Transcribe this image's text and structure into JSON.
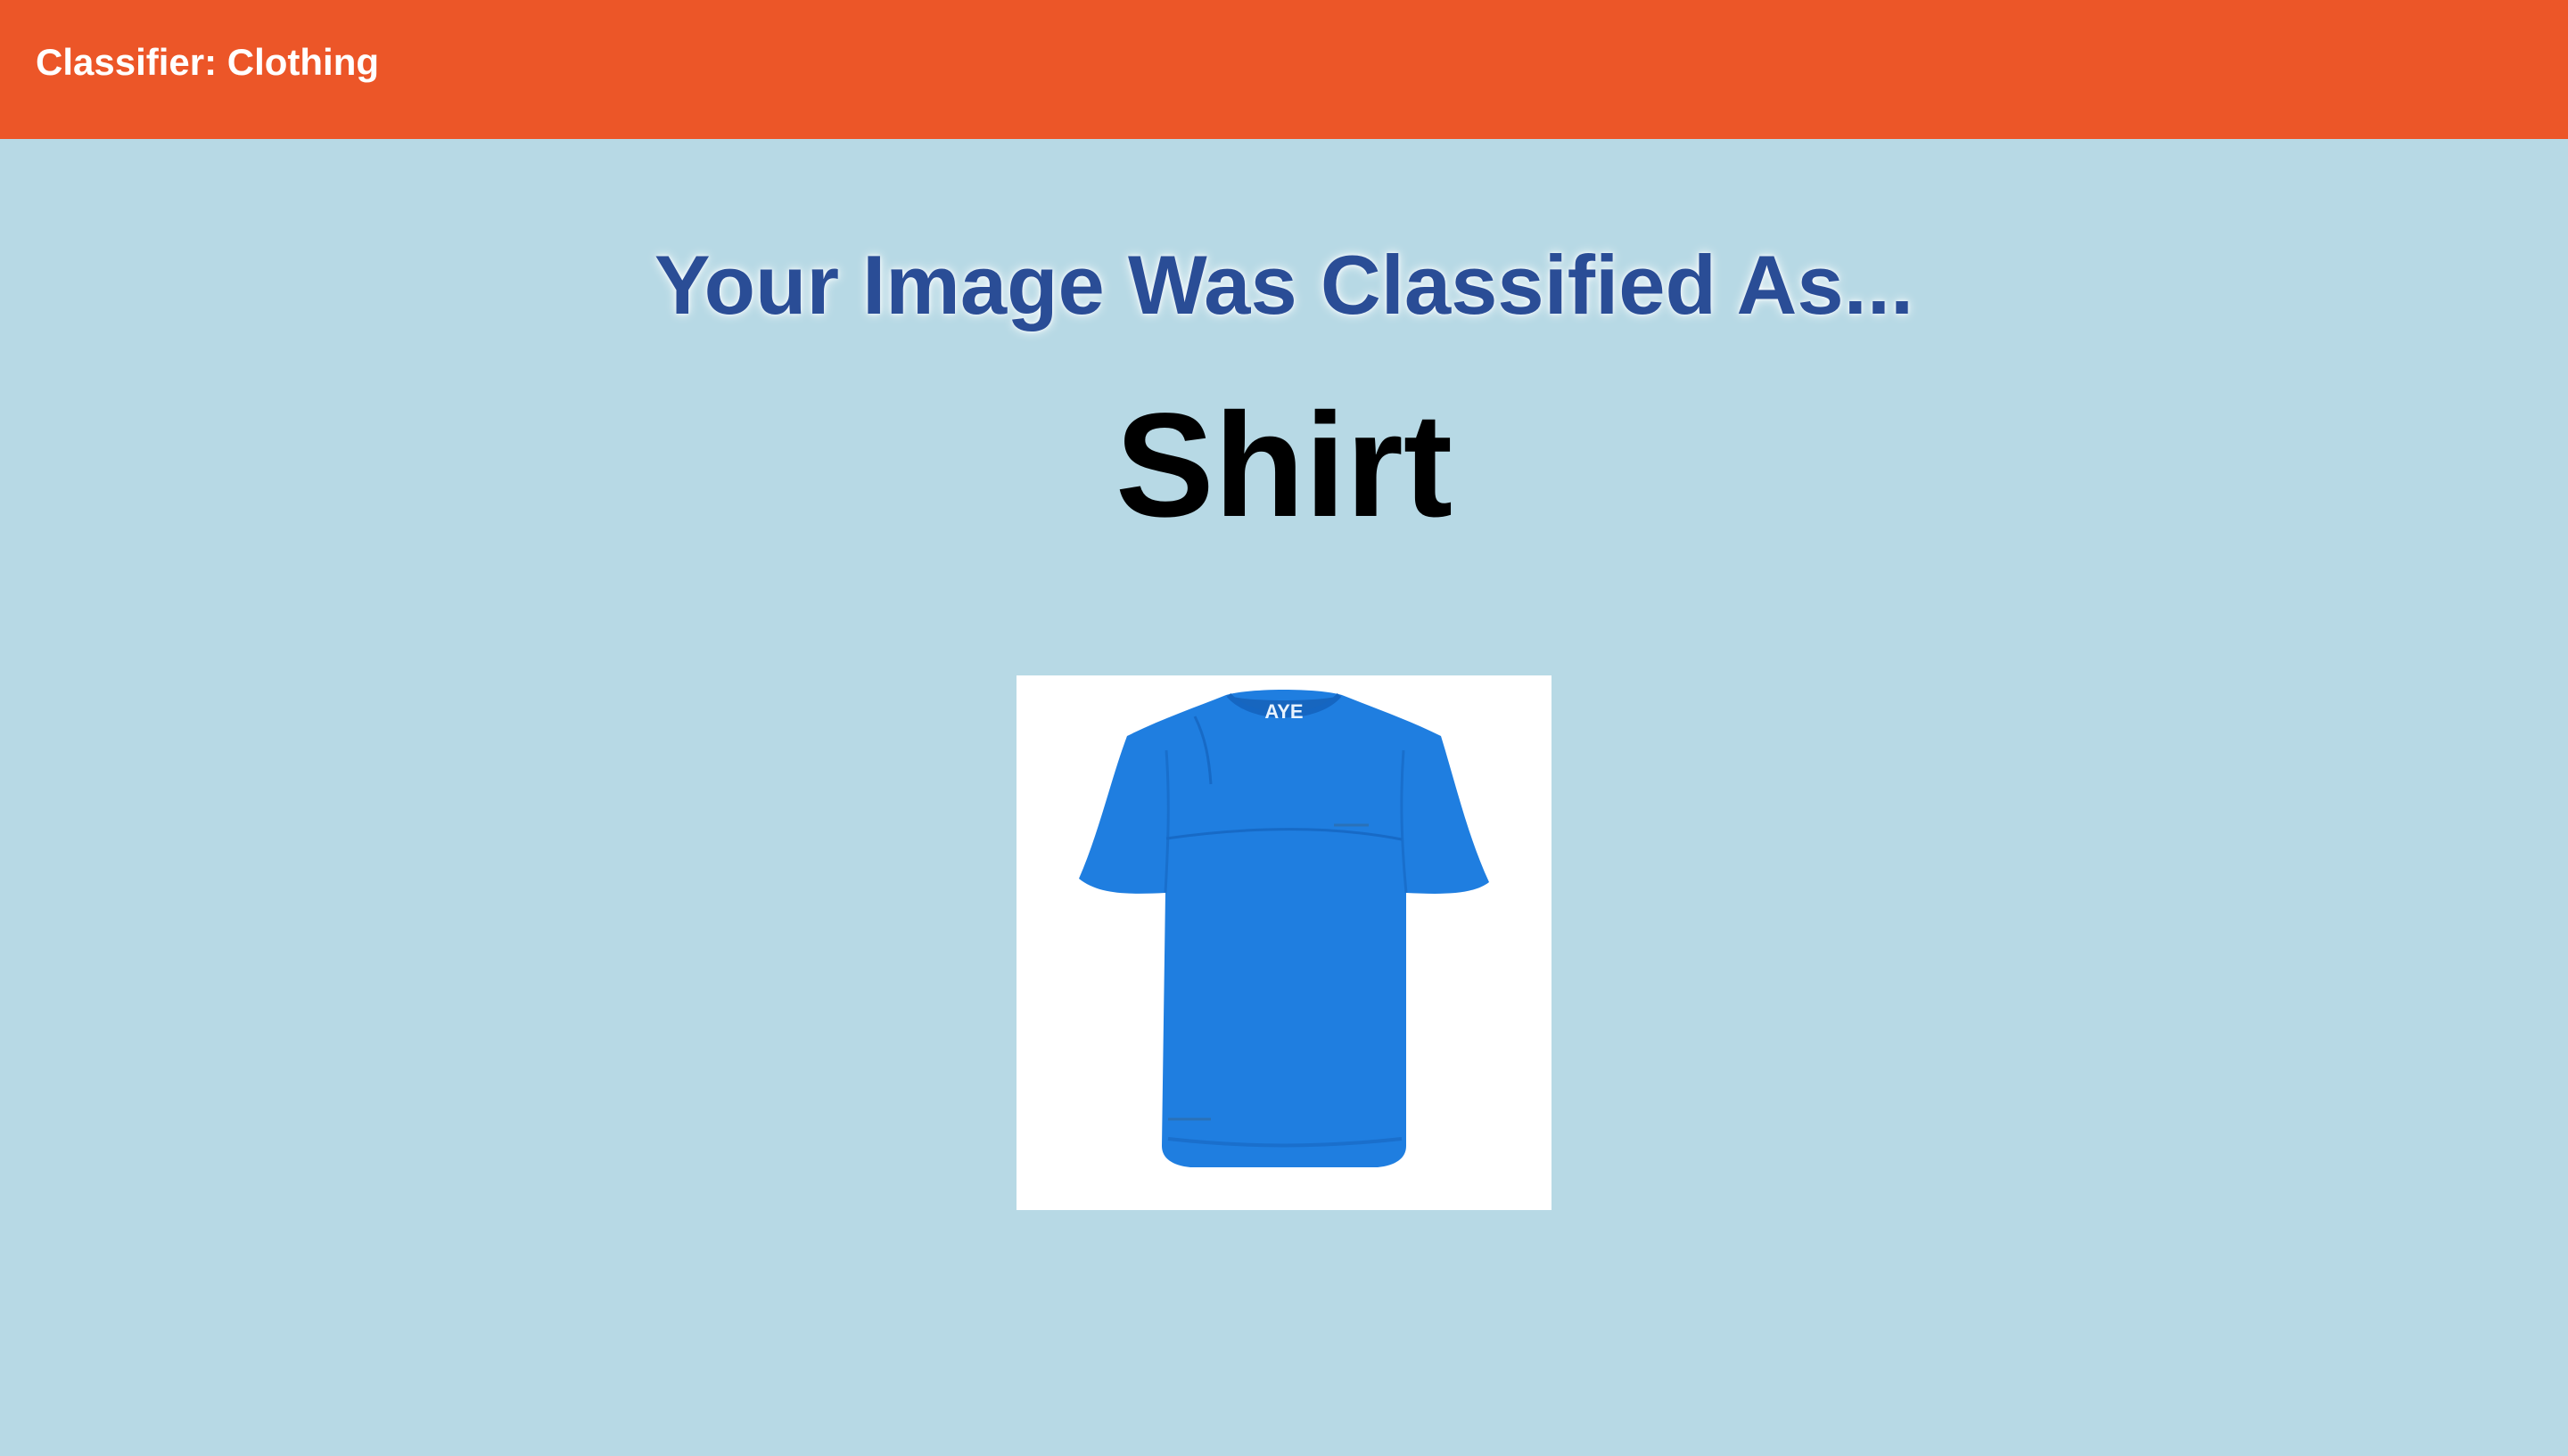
{
  "header": {
    "title": "Classifier: Clothing",
    "color": "#ec5628"
  },
  "main": {
    "heading": "Your Image Was Classified As...",
    "heading_color": "#2a4d96",
    "result_label": "Shirt",
    "background_color": "#b7d9e5"
  },
  "image": {
    "subject": "blue t-shirt",
    "shirt_color": "#1f7ee0",
    "logo_text": "AYE"
  }
}
